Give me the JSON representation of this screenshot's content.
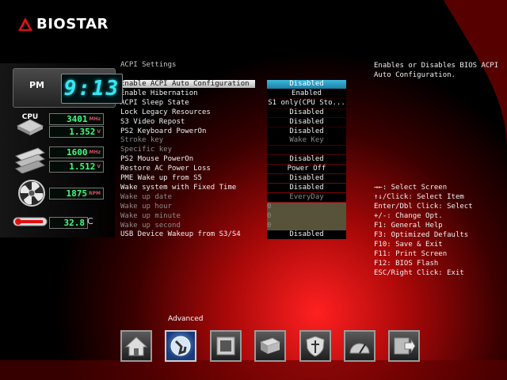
{
  "brand": {
    "name": "BIOSTAR",
    "accent": "#e0101a"
  },
  "monitor": {
    "ampm": "PM",
    "time": "9:13",
    "cpu_label": "CPU",
    "cpu_freq": "3401",
    "cpu_freq_unit": "MHz",
    "cpu_volt": "1.352",
    "cpu_volt_unit": "V",
    "mem_freq": "1600",
    "mem_freq_unit": "MHz",
    "mem_volt": "1.512",
    "mem_volt_unit": "V",
    "fan_rpm": "1875",
    "fan_unit": "RPM",
    "temp": "32.8",
    "temp_unit": "C"
  },
  "page": {
    "section_title": "ACPI Settings"
  },
  "settings": [
    {
      "label": "Enable ACPI Auto Configuration",
      "value": "Disabled",
      "state": "selected"
    },
    {
      "label": "Enable Hibernation",
      "value": "Enabled",
      "state": "normal"
    },
    {
      "label": "ACPI Sleep State",
      "value": "S1 only(CPU Sto...",
      "state": "normal"
    },
    {
      "label": "Lock Legacy Resources",
      "value": "Disabled",
      "state": "normal"
    },
    {
      "label": "S3 Video Repost",
      "value": "Disabled",
      "state": "normal"
    },
    {
      "label": "PS2 Keyboard PowerOn",
      "value": "Disabled",
      "state": "normal"
    },
    {
      "label": "Stroke key",
      "value": "Wake Key",
      "state": "dim"
    },
    {
      "label": "Specific key",
      "value": "",
      "state": "dim"
    },
    {
      "label": "PS2 Mouse PowerOn",
      "value": "Disabled",
      "state": "normal"
    },
    {
      "label": "Restore AC Power Loss",
      "value": "Power Off",
      "state": "normal"
    },
    {
      "label": "PME Wake up from S5",
      "value": "Disabled",
      "state": "normal"
    },
    {
      "label": "Wake system with Fixed Time",
      "value": "Disabled",
      "state": "normal"
    },
    {
      "label": "Wake up date",
      "value": "EveryDay",
      "state": "dim"
    },
    {
      "label": "Wake up hour",
      "value": "0",
      "state": "dim"
    },
    {
      "label": "Wake up minute",
      "value": "0",
      "state": "dim"
    },
    {
      "label": "Wake up second",
      "value": "0",
      "state": "dim"
    },
    {
      "label": "USB Device Wakeup from S3/S4",
      "value": "Disabled",
      "state": "normal"
    }
  ],
  "help_text": "Enables or Disables BIOS ACPI Auto Configuration.",
  "key_help": [
    "→←: Select Screen",
    "↑↓/Click: Select Item",
    "Enter/Dbl Click: Select",
    "+/-: Change Opt.",
    "F1: General Help",
    "F3: Optimized Defaults",
    "F10: Save & Exit",
    "F11: Print Screen",
    "F12: BIOS Flash",
    "ESC/Right Click: Exit"
  ],
  "nav": {
    "active_label": "Advanced",
    "items": [
      {
        "icon": "home-icon"
      },
      {
        "icon": "advanced-icon"
      },
      {
        "icon": "chipset-icon"
      },
      {
        "icon": "boot-icon"
      },
      {
        "icon": "security-icon"
      },
      {
        "icon": "o-n-e-icon"
      },
      {
        "icon": "save-exit-icon"
      }
    ]
  }
}
